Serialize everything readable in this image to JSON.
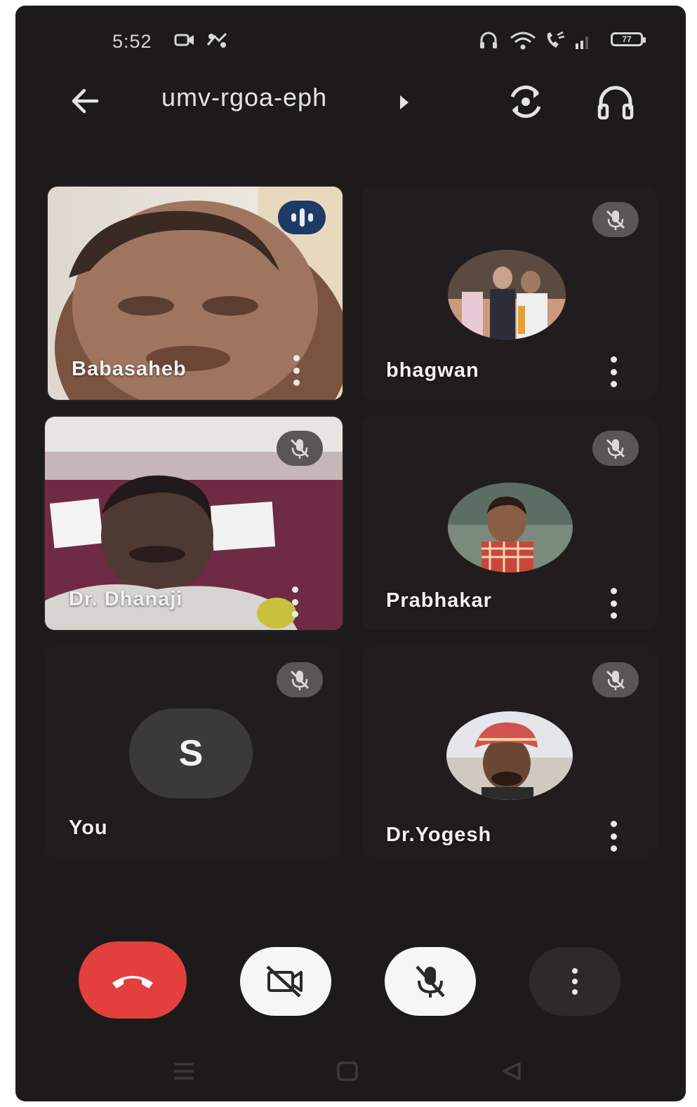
{
  "status_bar": {
    "time": "5:52",
    "icons": [
      "camera-icon",
      "sync-icon",
      "headset-icon",
      "wifi-icon",
      "call-icon",
      "signal-icon",
      "battery-icon"
    ],
    "battery_level": "77"
  },
  "header": {
    "meeting_code": "umv-rgoa-eph",
    "back_icon": "arrow-left-icon",
    "flip_camera_icon": "switch-camera-icon",
    "audio_output_icon": "headphones-icon"
  },
  "participants": [
    {
      "name": "Babasaheb",
      "video": true,
      "speaking": true
    },
    {
      "name": "bhagwan",
      "video": false,
      "muted": true
    },
    {
      "name": "Dr. Dhanaji",
      "video": true,
      "muted": true
    },
    {
      "name": "Prabhakar",
      "video": false,
      "muted": true
    },
    {
      "name": "You",
      "video": false,
      "muted": true,
      "initial": "S"
    },
    {
      "name": "Dr.Yogesh",
      "video": false,
      "muted": true
    }
  ],
  "controls": {
    "end_call": "end-call-icon",
    "camera_off": "video-off-icon",
    "mic_off": "mic-off-icon",
    "more": "more-vertical-icon"
  },
  "colors": {
    "background": "#1d1a1b",
    "end_call": "#e23f3d",
    "speaking_badge": "#1e3a66",
    "muted_badge": "#5a5556"
  }
}
